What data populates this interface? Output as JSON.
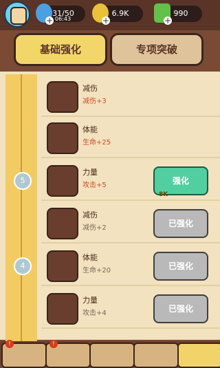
{
  "resources": {
    "energy": "31/50",
    "energy_timer": "06:43",
    "gold": "6.9K",
    "gems": "990"
  },
  "tabs": [
    "基础强化",
    "专项突破"
  ],
  "milestones": [
    "5",
    "4"
  ],
  "items": [
    {
      "name": "减伤",
      "bonus": "减伤+3",
      "bonus_color": "#d24a2a",
      "button": ""
    },
    {
      "name": "体能",
      "bonus": "生命+25",
      "bonus_color": "#d24a2a",
      "button": ""
    },
    {
      "name": "力量",
      "bonus": "攻击+5",
      "bonus_color": "#d24a2a",
      "button": "强化",
      "cost": "8K",
      "state": "upgrade"
    },
    {
      "name": "减伤",
      "bonus": "减伤+2",
      "bonus_color": "#7a6a5a",
      "button": "已强化",
      "state": "done"
    },
    {
      "name": "体能",
      "bonus": "生命+20",
      "bonus_color": "#7a6a5a",
      "button": "已强化",
      "state": "done"
    },
    {
      "name": "力量",
      "bonus": "攻击+4",
      "bonus_color": "#7a6a5a",
      "button": "已强化",
      "state": "done"
    }
  ],
  "icons": [
    "shield-icon",
    "heart-icon",
    "fist-icon"
  ],
  "nav": [
    "chest-icon",
    "helmet-icon",
    "sword-icon",
    "chicken-icon",
    "crystal-ball-icon"
  ],
  "colors": {
    "tab_active": "#f3d66a",
    "tab_inactive": "#dfc39b",
    "upgrade": "#52cfa0",
    "done": "#b9b9b9"
  }
}
